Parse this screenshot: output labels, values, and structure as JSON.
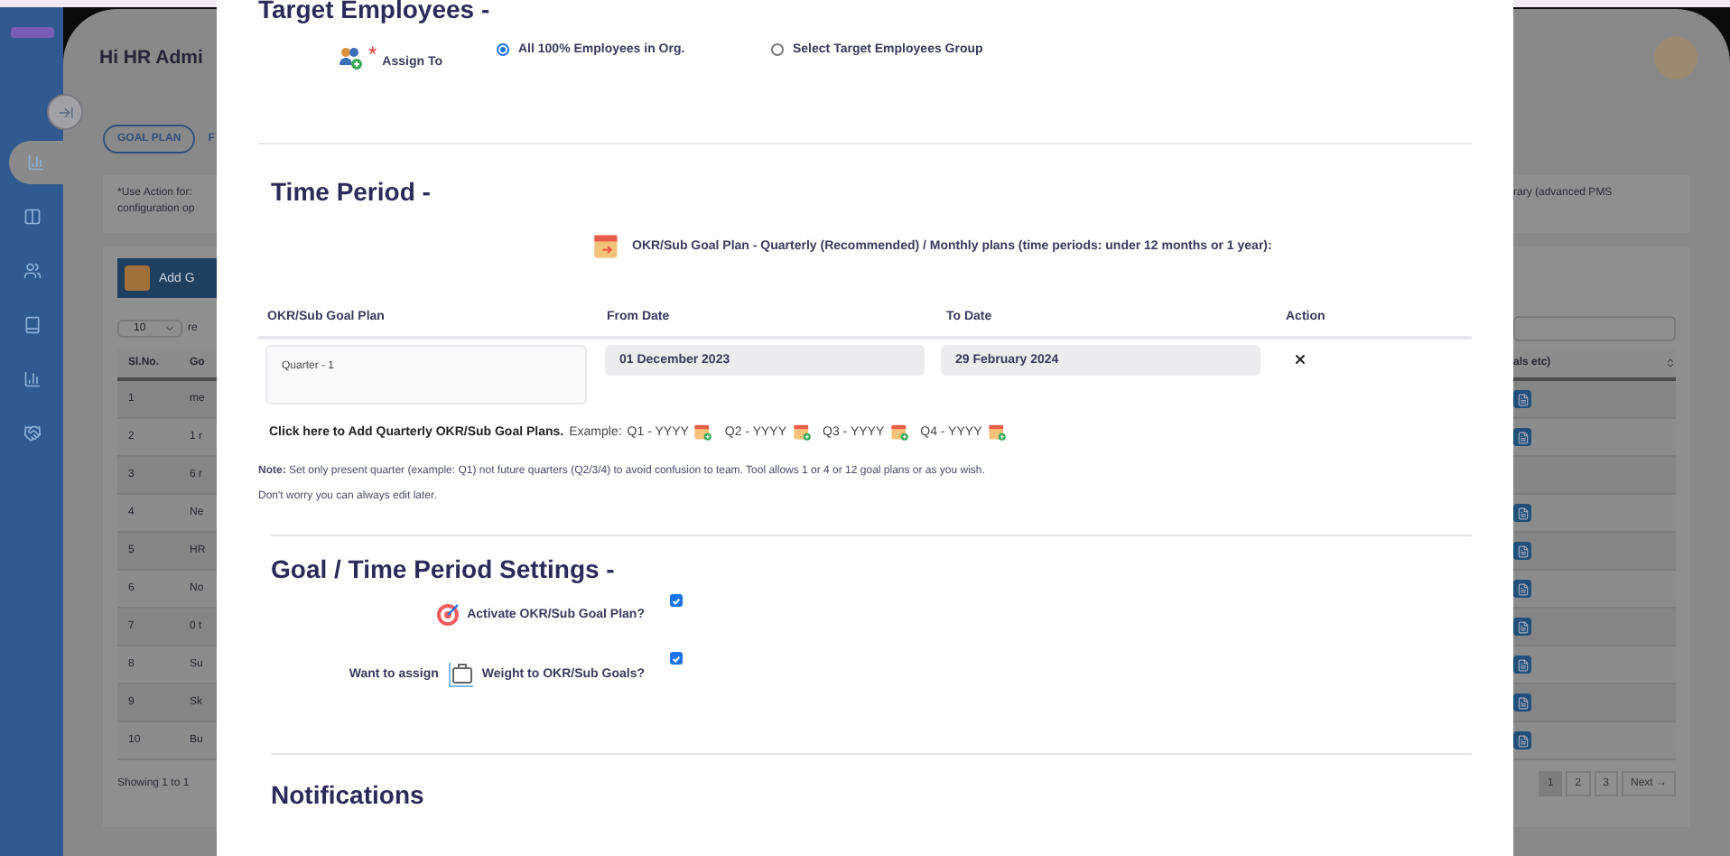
{
  "sidebar": {
    "items": [
      {
        "selected": true
      },
      {
        "selected": false
      },
      {
        "selected": false
      },
      {
        "selected": false
      },
      {
        "selected": false
      },
      {
        "selected": false
      }
    ]
  },
  "header": {
    "greeting": "Hi HR Admi"
  },
  "tabs": [
    {
      "label": "GOAL PLAN",
      "selected": true
    },
    {
      "label": "F",
      "selected": false
    }
  ],
  "info": {
    "left": [
      "*Use Action for:",
      "configuration op"
    ],
    "right": "rary (advanced PMS"
  },
  "goals": {
    "add_button": "Add G",
    "page_size": "10",
    "page_size_suffix": "re",
    "columns": [
      "Sl.No.",
      "Go"
    ],
    "last_column": "als etc)",
    "rows": [
      {
        "sl": "1",
        "goal": "me",
        "has_document": true
      },
      {
        "sl": "2",
        "goal": "1 r",
        "has_document": true
      },
      {
        "sl": "3",
        "goal": "6 r",
        "has_document": false
      },
      {
        "sl": "4",
        "goal": "Ne",
        "has_document": true
      },
      {
        "sl": "5",
        "goal": "HR",
        "has_document": true
      },
      {
        "sl": "6",
        "goal": "No",
        "has_document": true
      },
      {
        "sl": "7",
        "goal": "0 t",
        "has_document": true
      },
      {
        "sl": "8",
        "goal": "Su",
        "has_document": true
      },
      {
        "sl": "9",
        "goal": "Sk",
        "has_document": true
      },
      {
        "sl": "10",
        "goal": "Bu",
        "has_document": true
      }
    ],
    "footer": "Showing 1 to 1",
    "pages": [
      {
        "label": "1",
        "selected": true
      },
      {
        "label": "2",
        "selected": false
      },
      {
        "label": "3",
        "selected": false
      }
    ],
    "next": "Next →"
  },
  "modal": {
    "target_employees": {
      "title": "Target Employees -",
      "assign_label": "Assign To",
      "required_mark": "*",
      "options": [
        {
          "label": "All 100% Employees in Org.",
          "selected": true
        },
        {
          "label": "Select Target Employees Group",
          "selected": false
        }
      ]
    },
    "time_period": {
      "title": "Time Period -",
      "plan_type": "OKR/Sub Goal Plan - Quarterly (Recommended) / Monthly plans (time periods: under 12 months or 1 year):",
      "columns": [
        "OKR/Sub Goal Plan",
        "From Date",
        "To Date",
        "Action"
      ],
      "rows": [
        {
          "plan": "Quarter - 1",
          "from": "01 December 2023",
          "to": "29 February 2024"
        }
      ],
      "add_link": "Click here to Add Quarterly OKR/Sub Goal Plans.",
      "example_label": "Example:",
      "examples": [
        "Q1 - YYYY",
        "Q2 - YYYY",
        "Q3 - YYYY",
        "Q4 - YYYY"
      ],
      "note": "**Note:** Set only present quarter (example: Q1) not future quarters (Q2/3/4) to avoid confusion to team. Tool allows 1 or 4 or 12 goal plans or as you wish.",
      "note_2": "Don't worry you can always edit later."
    },
    "settings": {
      "title": "Goal / Time Period Settings -",
      "options": [
        {
          "kind": "target",
          "label": "Activate OKR/Sub Goal Plan?",
          "checked": true
        },
        {
          "kind": "weight",
          "prefix": "Want to assign",
          "label": "Weight to OKR/Sub Goals?",
          "checked": true
        }
      ]
    },
    "notifications": {
      "title": "Notifications"
    }
  }
}
